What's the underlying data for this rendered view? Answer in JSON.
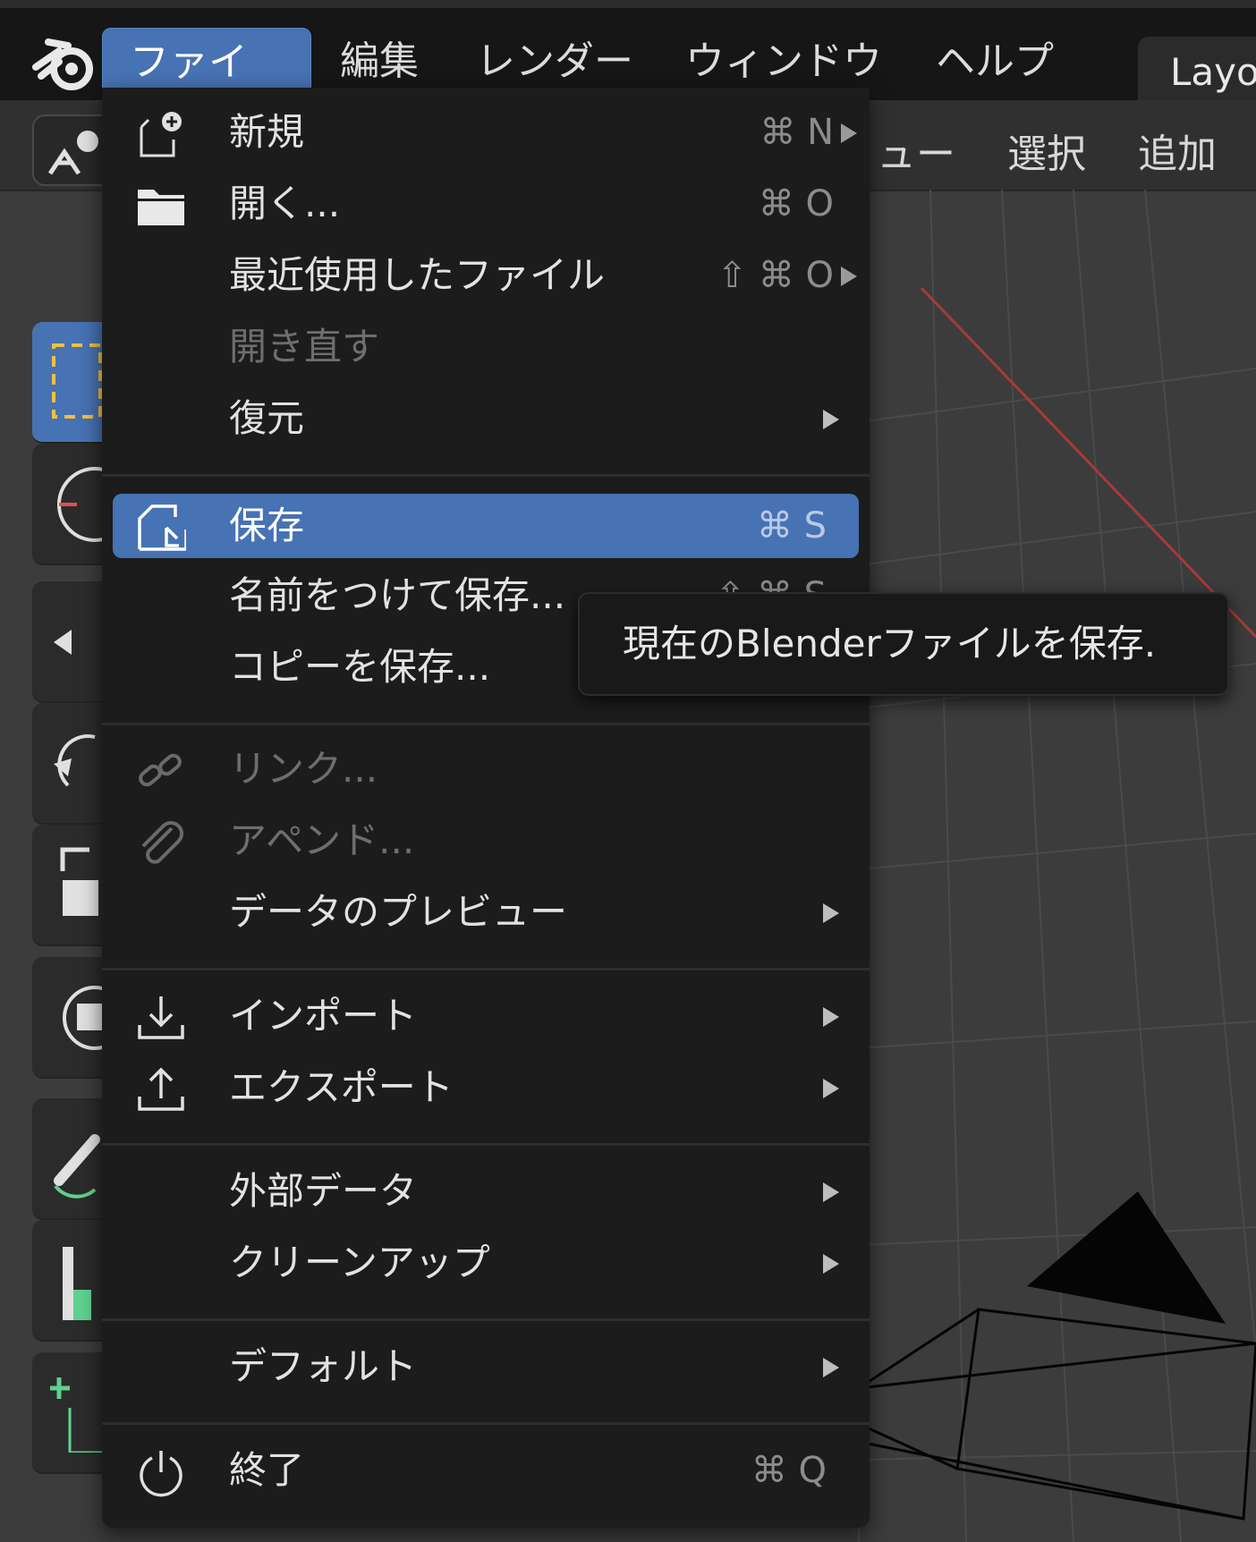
{
  "top_menu": {
    "file": "ファイル",
    "edit": "編集",
    "render": "レンダー",
    "window": "ウィンドウ",
    "help": "ヘルプ",
    "workspace_tab": "Layo"
  },
  "viewport_header": {
    "view": "ュー",
    "select": "選択",
    "add": "追加"
  },
  "file_menu": {
    "new": {
      "label": "新規",
      "shortcut": "⌘ N"
    },
    "open": {
      "label": "開く...",
      "shortcut": "⌘ O"
    },
    "recent": {
      "label": "最近使用したファイル",
      "shortcut": "⇧ ⌘ O"
    },
    "revert": {
      "label": "開き直す"
    },
    "recover": {
      "label": "復元"
    },
    "save": {
      "label": "保存",
      "shortcut": "⌘ S"
    },
    "save_as": {
      "label": "名前をつけて保存...",
      "shortcut": "⇧ ⌘ S"
    },
    "save_copy": {
      "label": "コピーを保存..."
    },
    "link": {
      "label": "リンク..."
    },
    "append": {
      "label": "アペンド..."
    },
    "data_previews": {
      "label": "データのプレビュー"
    },
    "import": {
      "label": "インポート"
    },
    "export": {
      "label": "エクスポート"
    },
    "external_data": {
      "label": "外部データ"
    },
    "clean_up": {
      "label": "クリーンアップ"
    },
    "defaults": {
      "label": "デフォルト"
    },
    "quit": {
      "label": "終了",
      "shortcut": "⌘ Q"
    }
  },
  "tooltip": {
    "text": "現在のBlenderファイルを保存."
  },
  "icons": {
    "logo": "blender-logo-icon",
    "new": "new-file-icon",
    "open": "folder-icon",
    "save": "save-file-icon",
    "link": "link-icon",
    "append": "paperclip-icon",
    "import": "import-icon",
    "export": "export-icon",
    "quit": "power-icon"
  },
  "colors": {
    "accent": "#4772b3",
    "menu_bg": "#1c1c1c",
    "topbar_bg": "#161616"
  }
}
